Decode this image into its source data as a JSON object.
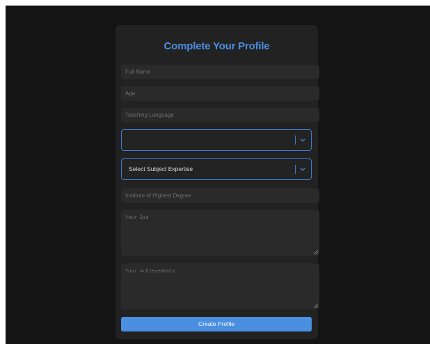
{
  "form": {
    "title": "Complete Your Profile",
    "full_name_placeholder": "Full Name",
    "age_placeholder": "Age",
    "teaching_language_placeholder": "Teaching Language",
    "first_select_value": "",
    "subject_select_value": "Select Subject Expertise",
    "institute_placeholder": "Institute of Highest Degree",
    "bio_placeholder": "Your Bio",
    "achievements_placeholder": "Your Achievements",
    "submit_label": "Create Profile"
  },
  "colors": {
    "accent": "#4a8fe0",
    "card_background": "#222222",
    "page_background": "#141414"
  },
  "icons": {
    "dropdown": "chevron-down-icon",
    "resize": "resize-grip-icon"
  }
}
